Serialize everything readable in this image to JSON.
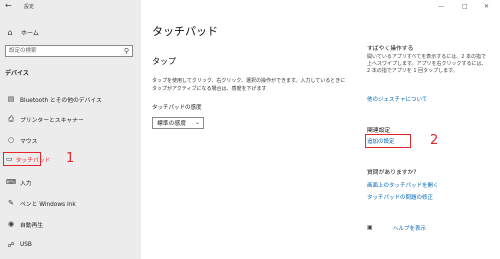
{
  "window": {
    "app_title": "設定",
    "back_icon": "arrow-left-icon"
  },
  "sidebar": {
    "home_label": "ホーム",
    "search_placeholder": "設定の検索",
    "section_label": "デバイス",
    "items": [
      {
        "label": "Bluetooth とその他のデバイス",
        "icon": "bluetooth-device-icon"
      },
      {
        "label": "プリンターとスキャナー",
        "icon": "printer-icon"
      },
      {
        "label": "マウス",
        "icon": "mouse-icon"
      },
      {
        "label": "タッチパッド",
        "icon": "touchpad-icon",
        "selected": true
      },
      {
        "label": "入力",
        "icon": "keyboard-icon"
      },
      {
        "label": "ペンと Windows Ink",
        "icon": "pen-icon"
      },
      {
        "label": "自動再生",
        "icon": "autoplay-icon"
      },
      {
        "label": "USB",
        "icon": "usb-icon"
      }
    ]
  },
  "main": {
    "title": "タッチパッド",
    "tap_heading": "タップ",
    "tap_description": "タップを使用してクリック、右クリック、選択の操作ができます。入力しているときにタップがアクティブになる場合は、感度を下げます",
    "sensitivity_label": "タッチパッドの感度",
    "sensitivity_value": "標準の感度"
  },
  "right_panel": {
    "quick_heading": "すばやく操作する",
    "quick_desc": "開いているアプリすべてを表示するには、2 本の指で上へスワイプします。アプリを右クリックするには、2 本の指でアプリを 1 回タップします。",
    "gestures_link": "他のジェスチャについて",
    "related_heading": "関連設定",
    "additional_link": "追加の設定",
    "question_heading": "質問がありますか?",
    "question_links": [
      "画面上のタッチパッドを開く",
      "タッチパッドの問題の修正"
    ],
    "help_link": "ヘルプを表示"
  },
  "annotations": {
    "step1": "1",
    "step2": "2",
    "color": "#e3262b"
  },
  "colors": {
    "sidebar_bg": "#ececec",
    "link": "#0067b8",
    "highlight": "#e3262b"
  }
}
